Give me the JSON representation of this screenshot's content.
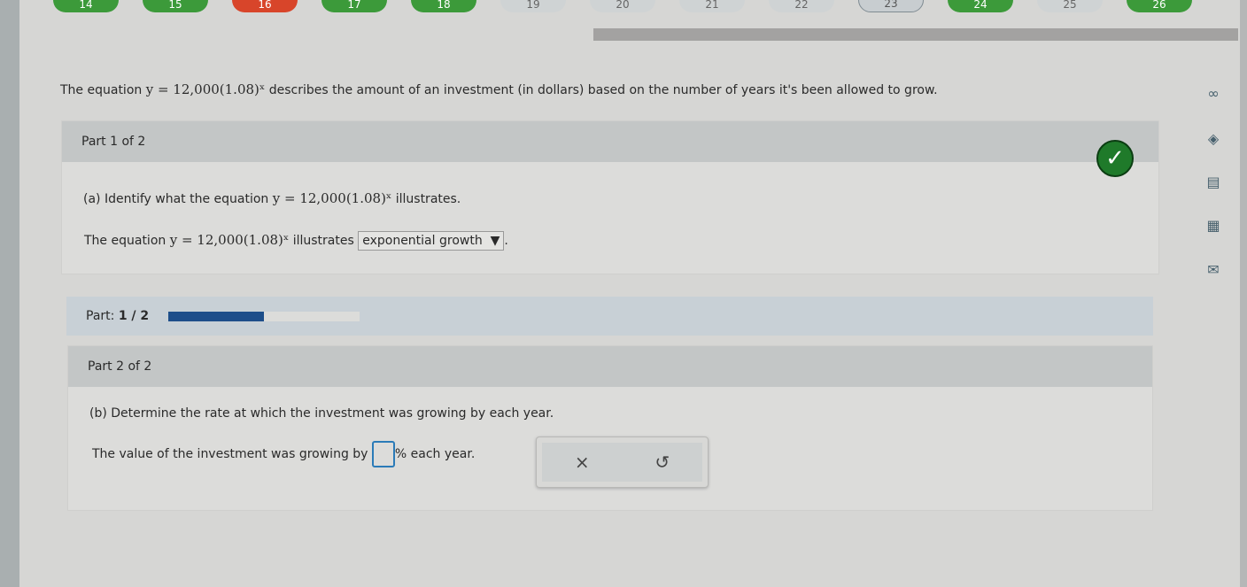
{
  "question_nav": [
    {
      "n": "14",
      "status": "correct"
    },
    {
      "n": "15",
      "status": "correct"
    },
    {
      "n": "16",
      "status": "incorrect"
    },
    {
      "n": "17",
      "status": "correct"
    },
    {
      "n": "18",
      "status": "correct"
    },
    {
      "n": "19",
      "status": "unanswered"
    },
    {
      "n": "20",
      "status": "unanswered"
    },
    {
      "n": "21",
      "status": "unanswered"
    },
    {
      "n": "22",
      "status": "unanswered"
    },
    {
      "n": "23",
      "status": "current"
    },
    {
      "n": "24",
      "status": "correct"
    },
    {
      "n": "25",
      "status": "unanswered"
    },
    {
      "n": "26",
      "status": "correct"
    }
  ],
  "stem": {
    "prefix": "The equation",
    "equation": "y = 12,000(1.08)ˣ",
    "suffix": "describes the amount of an investment (in dollars) based on the number of years it's been allowed to grow."
  },
  "part1": {
    "header": "Part 1 of 2",
    "question_prefix": "(a) Identify what the equation",
    "equation": "y = 12,000(1.08)ˣ",
    "question_suffix": "illustrates.",
    "answer_prefix": "The equation",
    "answer_mid": "illustrates",
    "dropdown_value": "exponential growth",
    "dropdown_arrow": "▼",
    "status": "correct"
  },
  "progress": {
    "label": "Part:",
    "value": "1 / 2",
    "fraction": 0.5
  },
  "part2": {
    "header": "Part 2 of 2",
    "question": "(b) Determine the rate at which the investment was growing by each year.",
    "answer_prefix": "The value of the investment was growing by",
    "unit": "%",
    "answer_suffix": "each year.",
    "answer_value": ""
  },
  "tools": {
    "clear": "×",
    "undo": "↺"
  },
  "sidebar_icons": [
    "glasses-icon",
    "hint-icon",
    "notes-icon",
    "ebook-icon",
    "mail-icon"
  ]
}
